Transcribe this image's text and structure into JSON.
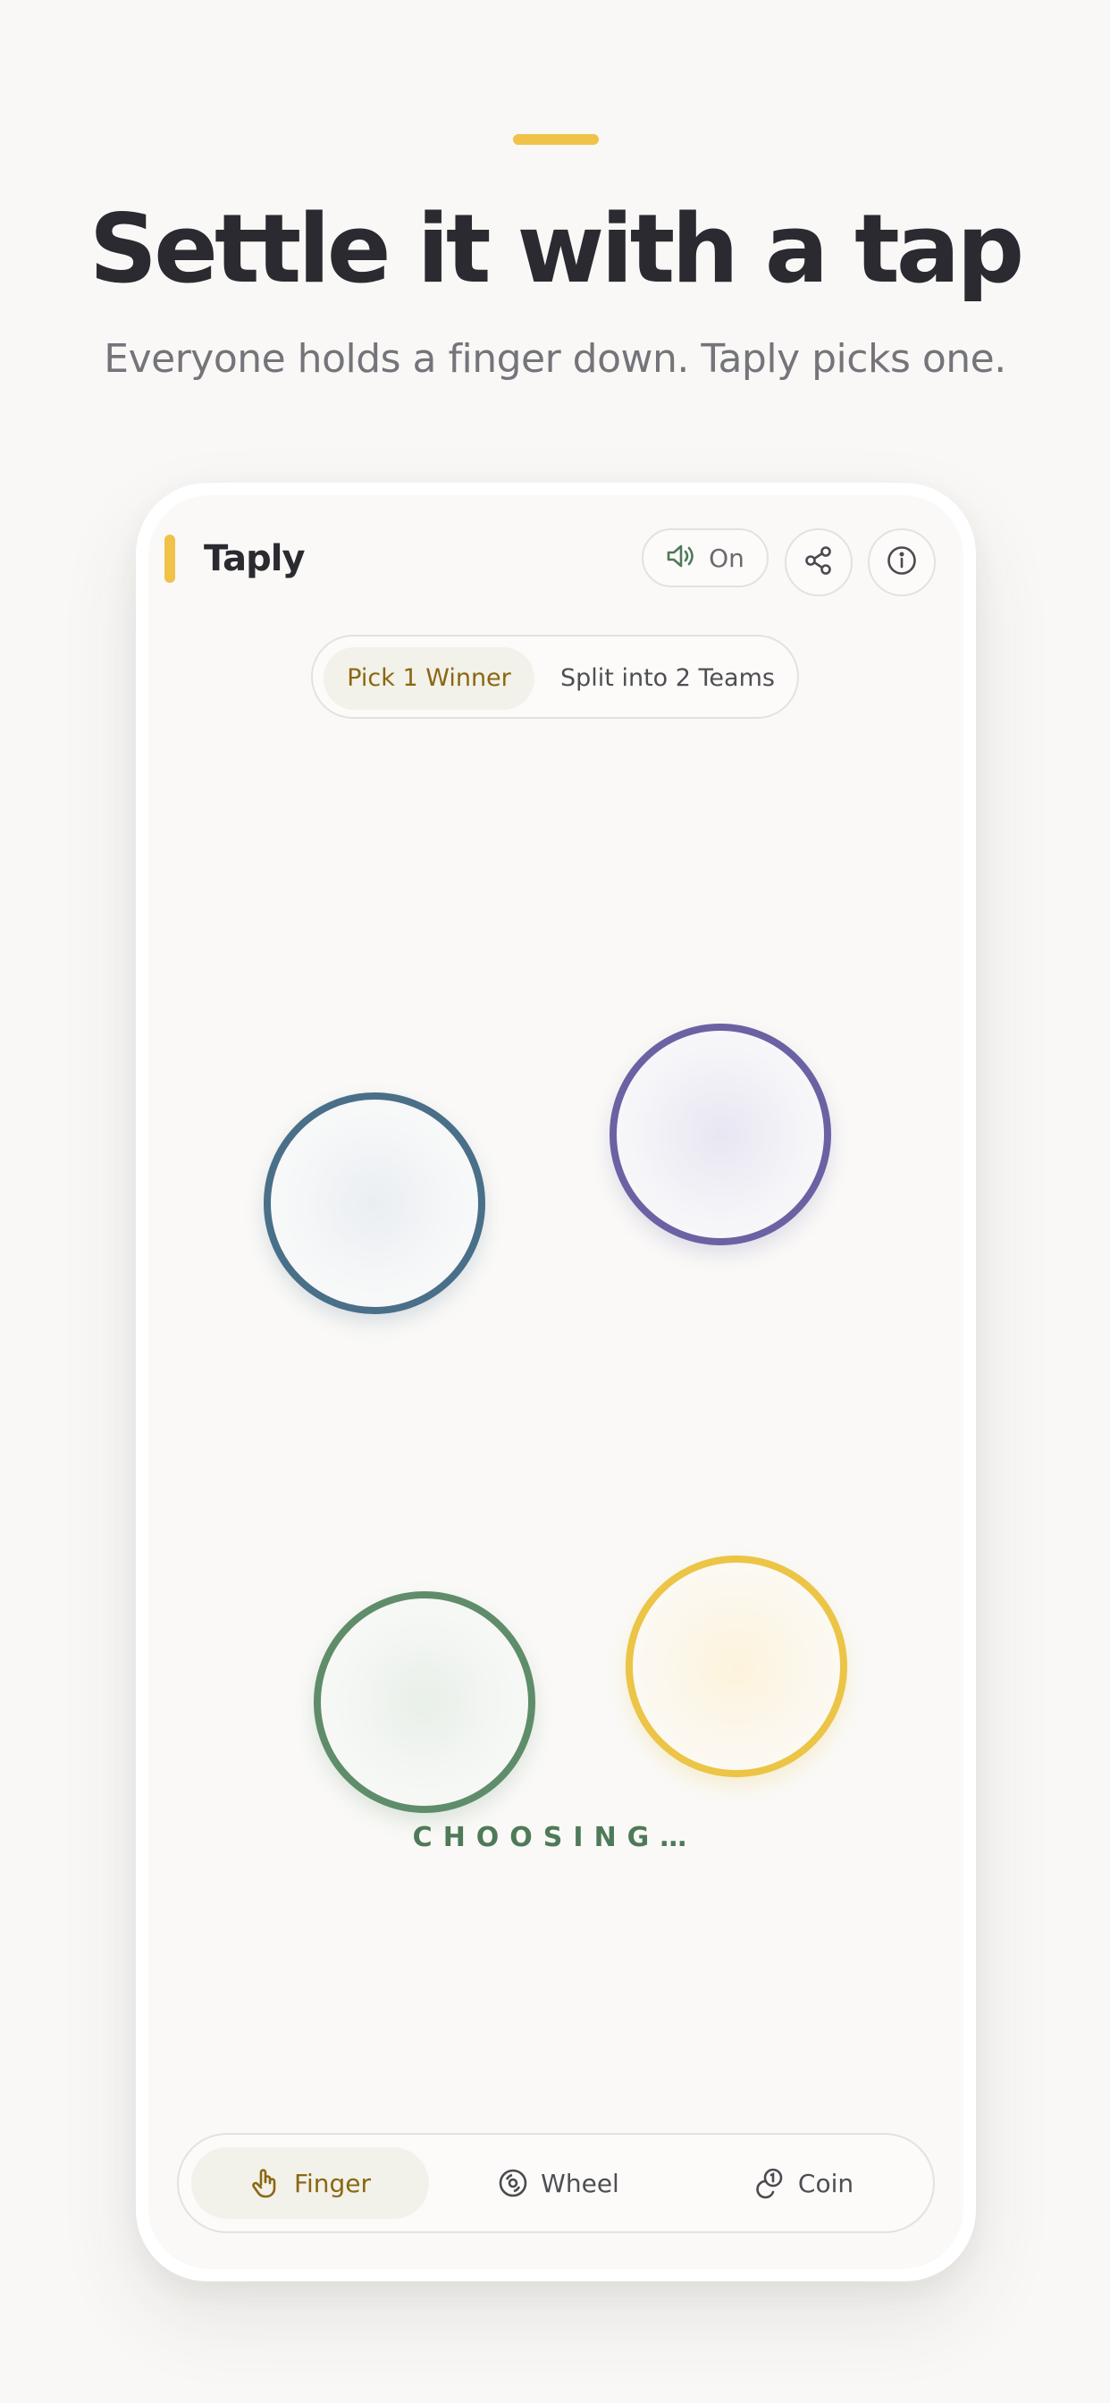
{
  "hero": {
    "headline": "Settle it with a tap",
    "subhead": "Everyone holds a finger down. Taply picks one."
  },
  "app": {
    "name": "Taply",
    "sound_label": "On",
    "modes": [
      "Pick 1 Winner",
      "Split into 2 Teams"
    ],
    "selected_mode": "Pick 1 Winner",
    "status": "CHOOSING…",
    "tabs": [
      {
        "label": "Finger",
        "icon": "hand-icon"
      },
      {
        "label": "Wheel",
        "icon": "wheel-icon"
      },
      {
        "label": "Coin",
        "icon": "coin-icon"
      }
    ],
    "selected_tab": "Finger",
    "touch_colors": [
      "#4a6f88",
      "#6a62a2",
      "#5f8d6a",
      "#ecc446"
    ]
  },
  "colors": {
    "accent": "#f0c24a",
    "selected_text": "#8a6710",
    "status": "#4e7a58"
  }
}
